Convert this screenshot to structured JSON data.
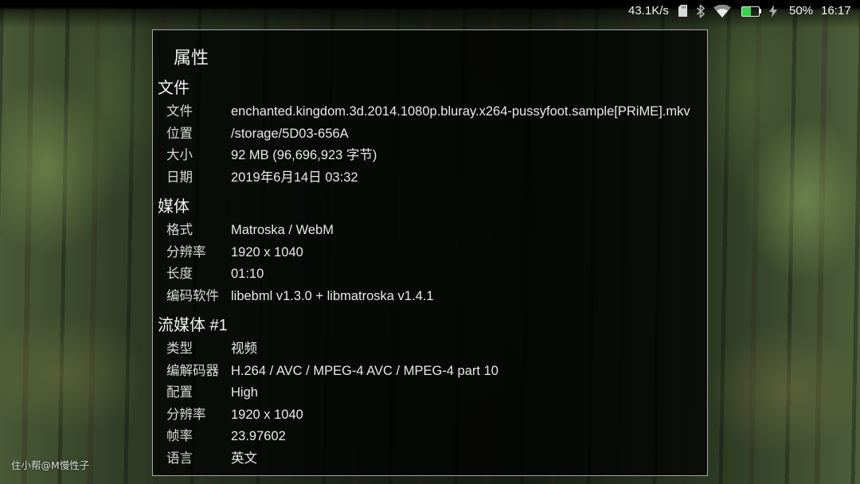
{
  "status_bar": {
    "net_speed": "43.1K/s",
    "battery_percent": "50%",
    "time": "16:17",
    "battery_level": 0.5,
    "battery_color": "#35d44a",
    "icons": {
      "sd_card": "sd-card-icon",
      "bluetooth": "bluetooth-icon",
      "wifi": "wifi-icon",
      "battery": "battery-icon",
      "charging": "charging-bolt-icon"
    }
  },
  "dialog": {
    "title": "属性",
    "sections": [
      {
        "heading": "文件",
        "rows": [
          {
            "label": "文件",
            "value": "enchanted.kingdom.3d.2014.1080p.bluray.x264-pussyfoot.sample[PRiME].mkv"
          },
          {
            "label": "位置",
            "value": "/storage/5D03-656A"
          },
          {
            "label": "大小",
            "value": "92 MB (96,696,923 字节)"
          },
          {
            "label": "日期",
            "value": "2019年6月14日 03:32"
          }
        ]
      },
      {
        "heading": "媒体",
        "rows": [
          {
            "label": "格式",
            "value": "Matroska / WebM"
          },
          {
            "label": "分辨率",
            "value": "1920 x 1040"
          },
          {
            "label": "长度",
            "value": "01:10"
          },
          {
            "label": "编码软件",
            "value": "libebml v1.3.0 + libmatroska v1.4.1"
          }
        ]
      },
      {
        "heading": "流媒体 #1",
        "rows": [
          {
            "label": "类型",
            "value": "视频"
          },
          {
            "label": "编解码器",
            "value": "H.264 / AVC / MPEG-4 AVC / MPEG-4 part 10"
          },
          {
            "label": "配置",
            "value": "High"
          },
          {
            "label": "分辨率",
            "value": "1920 x 1040"
          },
          {
            "label": "帧率",
            "value": "23.97602"
          },
          {
            "label": "语言",
            "value": "英文"
          }
        ]
      }
    ]
  },
  "watermark": "住小帮@M慢性子"
}
